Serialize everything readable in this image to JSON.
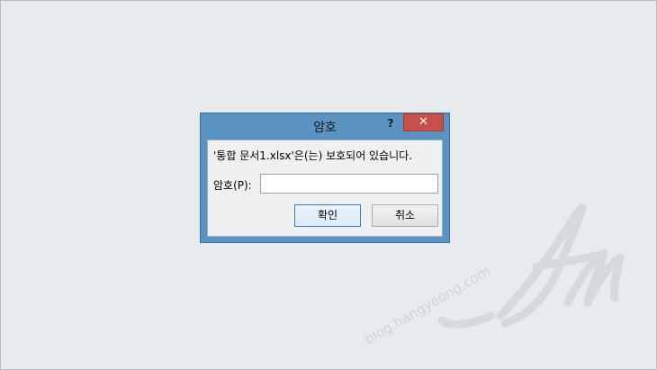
{
  "dialog": {
    "title": "암호",
    "help_label": "?",
    "close_label": "✕",
    "message": "'통합 문서1.xlsx'은(는) 보호되어 있습니다.",
    "password_label": "암호(P):",
    "password_value": "",
    "ok_label": "확인",
    "cancel_label": "취소"
  },
  "watermark": {
    "text": "blog.hangyeong.com"
  },
  "colors": {
    "titlebar": "#5a93c2",
    "close_button": "#c7504b",
    "desktop_background": "#e8ebee",
    "client_background": "#f0f0f0"
  }
}
